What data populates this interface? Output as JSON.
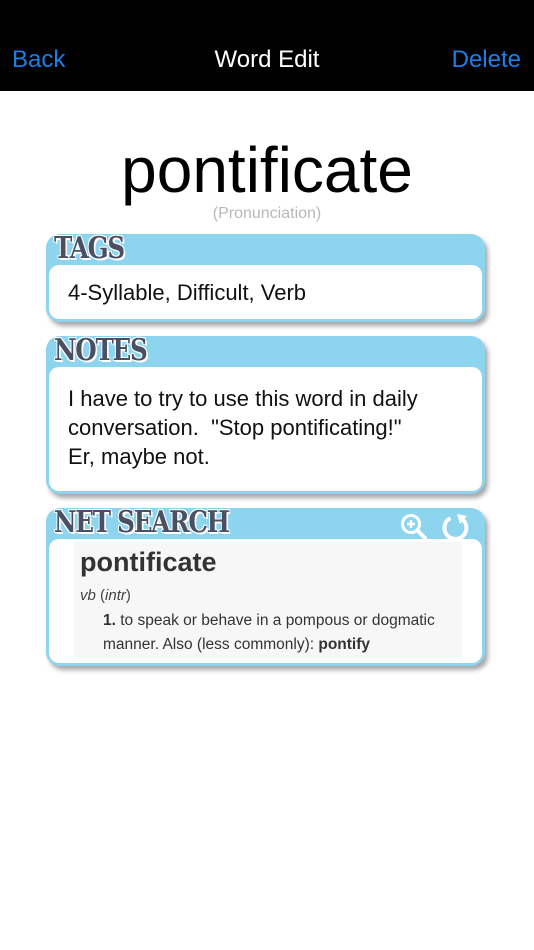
{
  "nav": {
    "back_label": "Back",
    "title": "Word Edit",
    "delete_label": "Delete",
    "accent_color": "#1a7fe6"
  },
  "word": {
    "text": "pontificate",
    "pronunciation_placeholder": "(Pronunciation)"
  },
  "tags": {
    "label": "TAGS",
    "value": "4-Syllable, Difficult, Verb"
  },
  "notes": {
    "label": "NOTES",
    "value": "I have to try to use this word in daily\nconversation.  \"Stop pontificating!\"\nEr, maybe not."
  },
  "net_search": {
    "label": "NET SEARCH",
    "icons": [
      "zoom-in-icon",
      "refresh-icon"
    ],
    "result": {
      "headword": "pontificate",
      "pos_abbr": "vb",
      "pos_paren": "(intr)",
      "pos_inner": "intr",
      "sense_number": "1.",
      "definition": " to speak or behave in a pompous or dogmatic manner. Also (less commonly): ",
      "synonym": "pontify"
    }
  },
  "colors": {
    "card_border": "#8dd4ef",
    "label_text": "#4a4f63",
    "nav_background": "#000000"
  }
}
